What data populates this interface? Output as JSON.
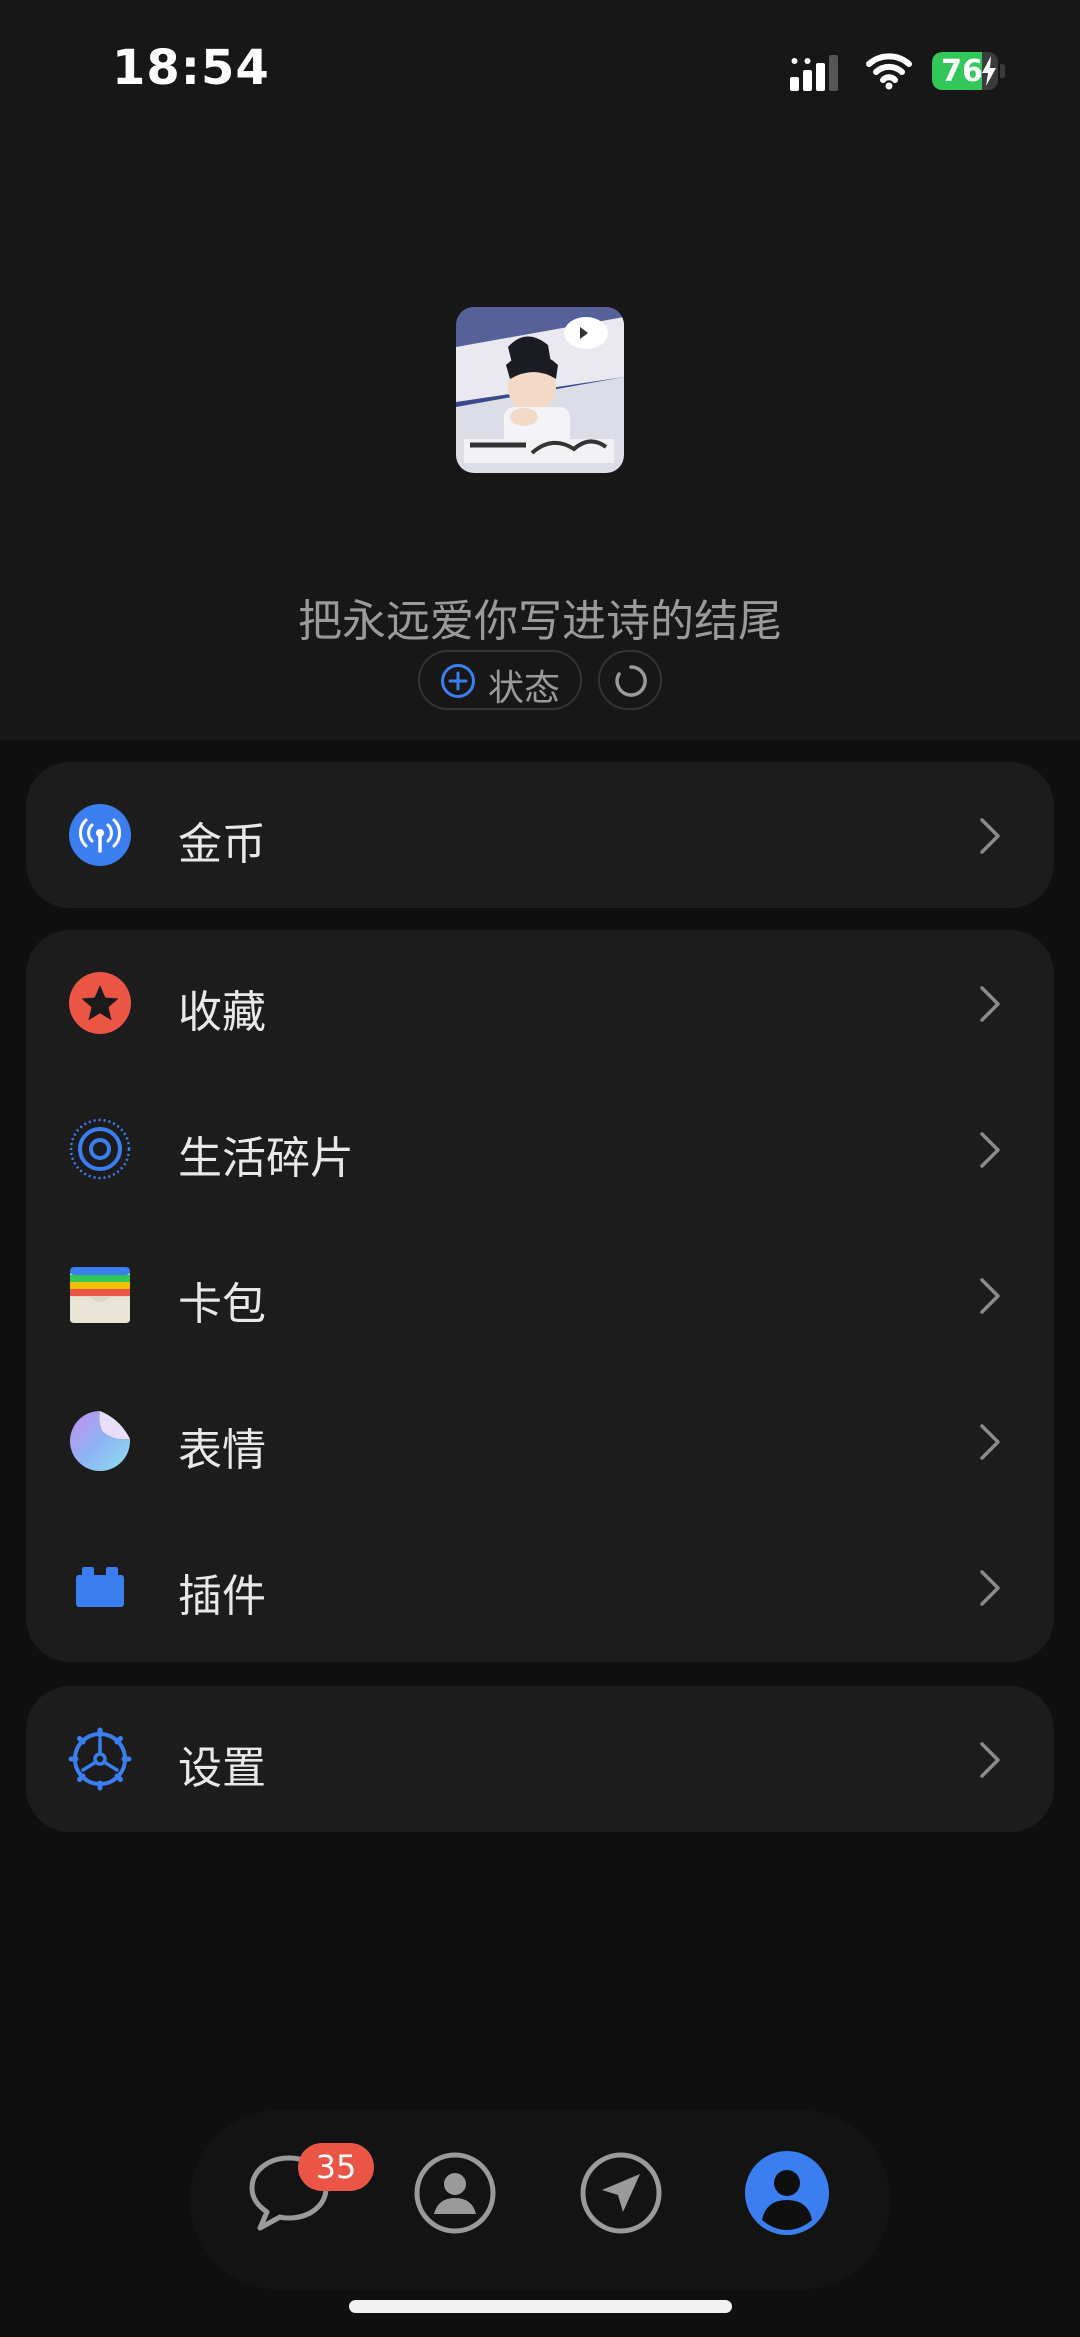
{
  "status_bar": {
    "time": "18:54",
    "battery": "76",
    "battery_level": 0.76
  },
  "profile": {
    "signature": "把永远爱你写进诗的结尾",
    "status_label": "状态"
  },
  "menu": {
    "coins": "金币",
    "favorites": "收藏",
    "life_moments": "生活碎片",
    "card_wallet": "卡包",
    "stickers": "表情",
    "plugins": "插件",
    "settings": "设置"
  },
  "tabbar": {
    "messages_badge": "35"
  },
  "colors": {
    "accent_blue": "#3b7ef0",
    "red": "#eb5545",
    "battery_green": "#32c759"
  }
}
